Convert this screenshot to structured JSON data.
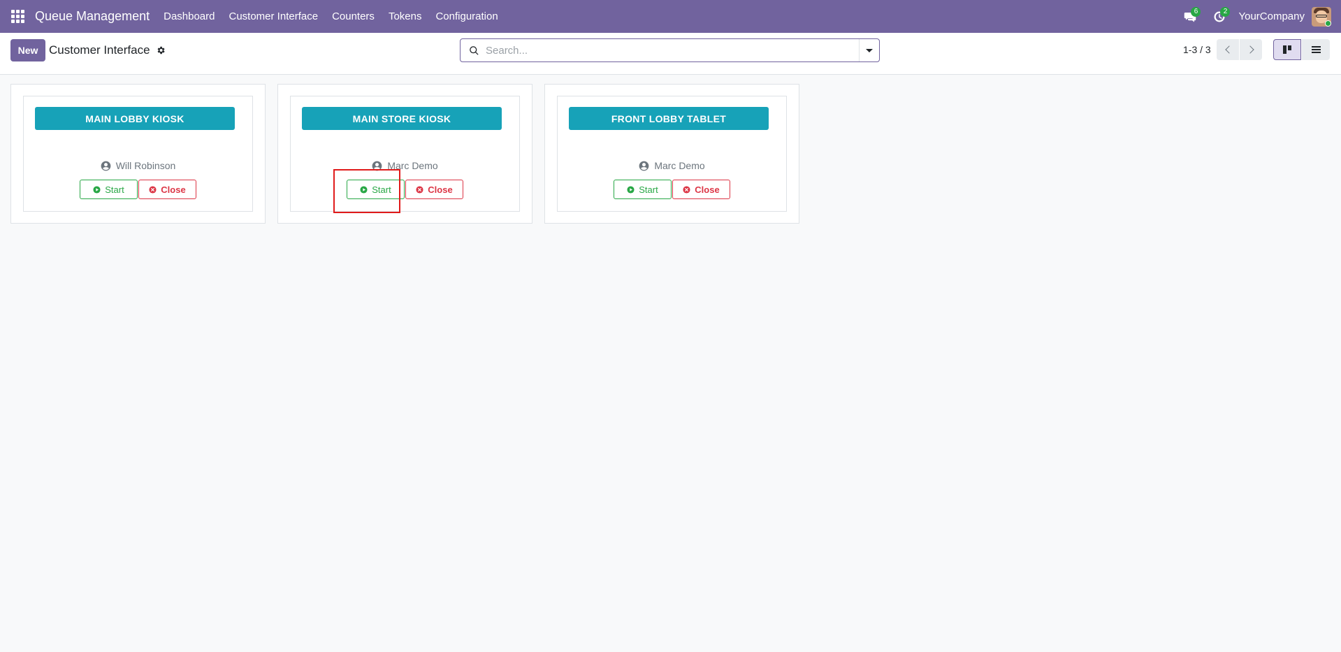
{
  "navbar": {
    "app_name": "Queue Management",
    "menu": [
      "Dashboard",
      "Customer Interface",
      "Counters",
      "Tokens",
      "Configuration"
    ],
    "messages_count": "6",
    "activities_count": "2",
    "company": "YourCompany",
    "color": "#71639e"
  },
  "control_panel": {
    "new_label": "New",
    "title": "Customer Interface",
    "search_placeholder": "Search...",
    "pager": "1-3 / 3"
  },
  "records": [
    {
      "title": "MAIN LOBBY KIOSK",
      "user": "Will Robinson",
      "start_label": "Start",
      "close_label": "Close"
    },
    {
      "title": "MAIN STORE KIOSK",
      "user": "Marc Demo",
      "start_label": "Start",
      "close_label": "Close"
    },
    {
      "title": "FRONT LOBBY TABLET",
      "user": "Marc Demo",
      "start_label": "Start",
      "close_label": "Close"
    }
  ],
  "colors": {
    "title_bar": "#17a2b8",
    "start": "#28a745",
    "close": "#dc3545",
    "highlight": "#e01b1b"
  }
}
